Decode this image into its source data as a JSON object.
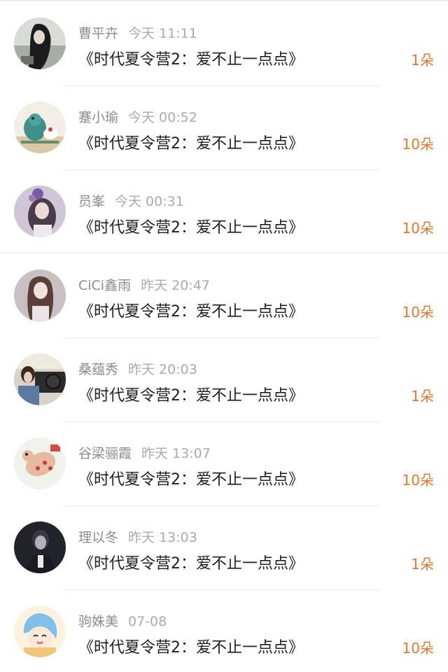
{
  "accent_color": "#e6762a",
  "records": [
    {
      "user": "曹平卉",
      "time": "今天 11:11",
      "gift": "《时代夏令营2：爱不止一点点》",
      "count": "1朵",
      "avatar_icon": "avatar-photo-dark-haired-girl"
    },
    {
      "user": "蹇小瑜",
      "time": "今天 00:52",
      "gift": "《时代夏令营2：爱不止一点点》",
      "count": "10朵",
      "avatar_icon": "avatar-cartoon-dinosaur"
    },
    {
      "user": "员峯",
      "time": "今天 00:31",
      "gift": "《时代夏令营2：爱不止一点点》",
      "count": "10朵",
      "avatar_icon": "avatar-photo-girl-flower"
    },
    {
      "user": "CiCi鑫雨",
      "time": "昨天 20:47",
      "gift": "《时代夏令营2：爱不止一点点》",
      "count": "10朵",
      "avatar_icon": "avatar-photo-long-hair-girl"
    },
    {
      "user": "桑蕴秀",
      "time": "昨天 20:03",
      "gift": "《时代夏令营2：爱不止一点点》",
      "count": "1朵",
      "avatar_icon": "avatar-photo-car-driver"
    },
    {
      "user": "谷梁骊霞",
      "time": "昨天 13:07",
      "gift": "《时代夏令营2：爱不止一点点》",
      "count": "10朵",
      "avatar_icon": "avatar-cartoon-bear"
    },
    {
      "user": "理以冬",
      "time": "昨天 13:03",
      "gift": "《时代夏令营2：爱不止一点点》",
      "count": "1朵",
      "avatar_icon": "avatar-photo-dark-portrait"
    },
    {
      "user": "驹姝美",
      "time": "07-08",
      "gift": "《时代夏令营2：爱不止一点点》",
      "count": "10朵",
      "avatar_icon": "avatar-cartoon-blue-hair-girl"
    }
  ]
}
